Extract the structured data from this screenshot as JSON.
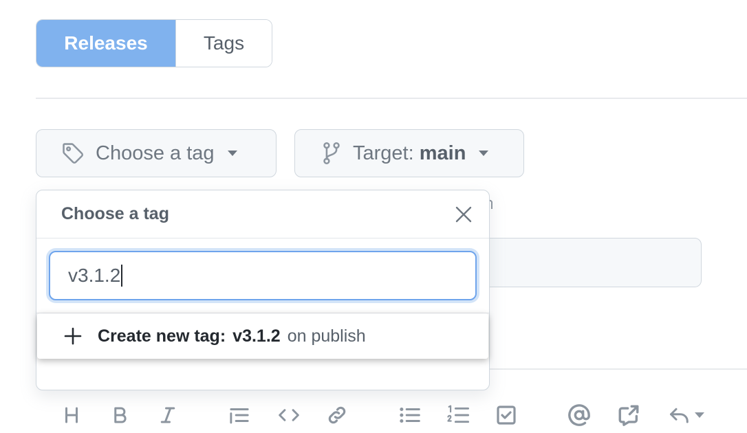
{
  "tabs": {
    "releases": "Releases",
    "tags": "Tags"
  },
  "tag_button": {
    "label": "Choose a tag"
  },
  "target_button": {
    "label": "Target:",
    "value": "main"
  },
  "dropdown": {
    "title": "Choose a tag",
    "filter_value": "v3.1.2",
    "create_prefix": "Create new tag:",
    "create_tag": "v3.1.2",
    "create_suffix": "on publish"
  },
  "toolbar": {
    "icons": [
      "heading-icon",
      "bold-icon",
      "italic-icon",
      "quote-icon",
      "code-icon",
      "link-icon",
      "unordered-list-icon",
      "ordered-list-icon",
      "task-list-icon",
      "mention-icon",
      "cross-reference-icon",
      "reply-icon"
    ]
  },
  "colors": {
    "accent": "#80b2ee",
    "focus": "#6ea4ec",
    "muted": "#8c959f"
  }
}
